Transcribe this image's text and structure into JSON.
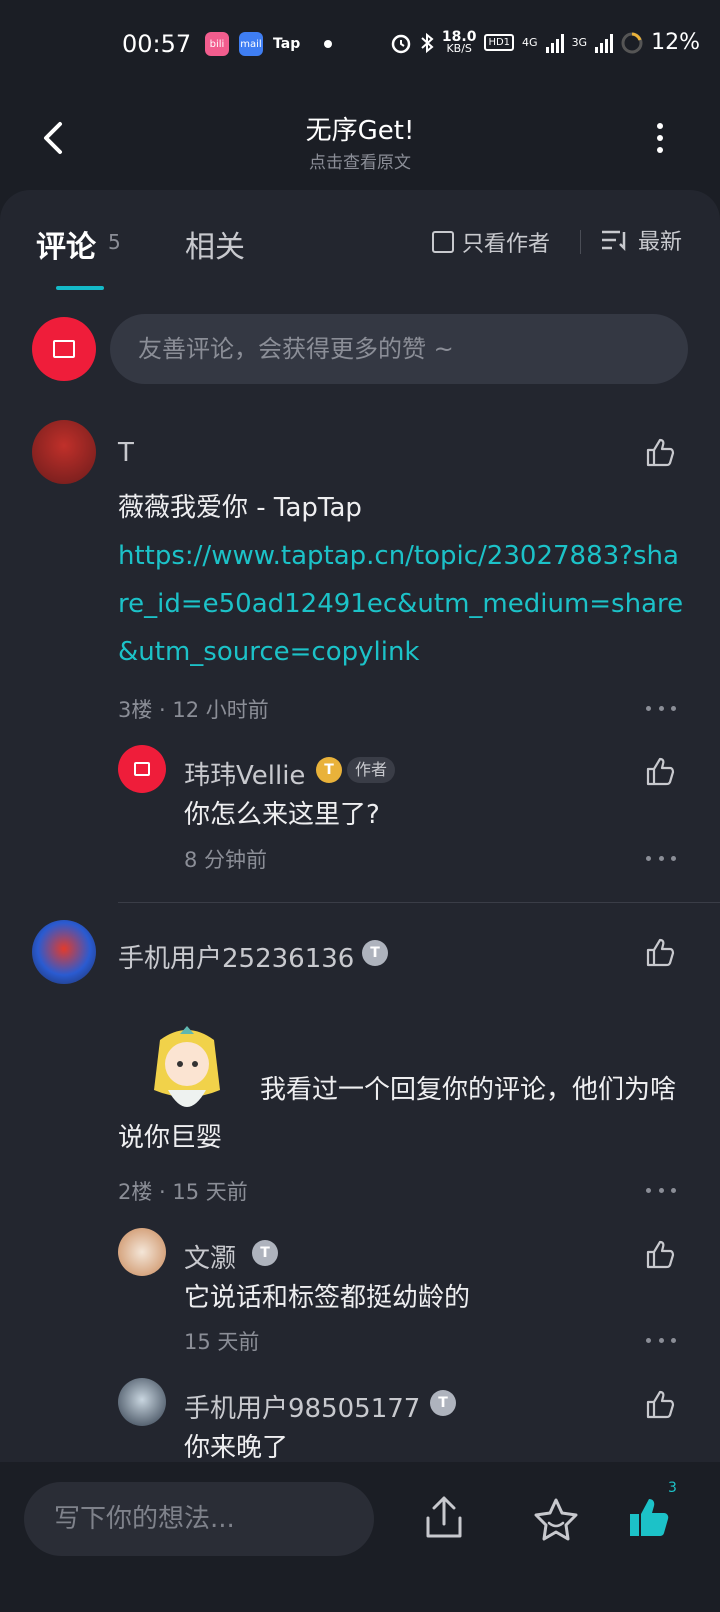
{
  "status_bar": {
    "time": "00:57",
    "apps": [
      "bili",
      "mail",
      "Tap"
    ],
    "net_speed_top": "18.0",
    "net_speed_unit": "KB/S",
    "hd": "HD1",
    "net1": "4G",
    "net2": "3G",
    "battery": "12%"
  },
  "header": {
    "title": "无序Get!",
    "subtitle": "点击查看原文"
  },
  "tabs": {
    "comments_label": "评论",
    "comments_count": "5",
    "related_label": "相关",
    "author_only_label": "只看作者",
    "sort_label": "最新"
  },
  "composer": {
    "placeholder": "友善评论，会获得更多的赞 ~"
  },
  "comments": [
    {
      "user": "T",
      "text": "薇薇我爱你 - TapTap",
      "link": "https://www.taptap.cn/topic/23027883?share_id=e50ad12491ec&utm_medium=share&utm_source=copylink",
      "floor": "3楼 · 12 小时前",
      "reply": {
        "user": "玮玮Vellie",
        "badge": "T",
        "tag": "作者",
        "text": "你怎么来这里了?",
        "time": "8 分钟前"
      }
    },
    {
      "user": "手机用户25236136",
      "badge": "T",
      "text": "我看过一个回复你的评论，他们为啥说你巨婴",
      "floor": "2楼 · 15 天前",
      "replies": [
        {
          "user": "文灏",
          "badge": "T",
          "text": "它说话和标签都挺幼龄的",
          "time": "15 天前"
        },
        {
          "user": "手机用户98505177",
          "badge": "T",
          "text": "你来晚了"
        }
      ]
    }
  ],
  "bottom": {
    "placeholder": "写下你的想法...",
    "like_count": "3"
  },
  "colors": {
    "accent": "#1cc2c8",
    "background": "#1b1e25",
    "panel": "#23262f"
  }
}
